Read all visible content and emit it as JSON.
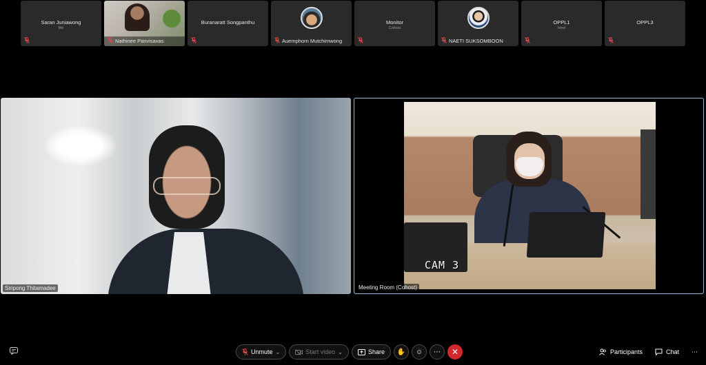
{
  "participants": [
    {
      "name": "Saran Juniawong",
      "role": "Me"
    },
    {
      "name": "Nathinee Panvisavas",
      "role": ""
    },
    {
      "name": "Buranaratt Songpanthu",
      "role": ""
    },
    {
      "name": "Auemphorn Mutchimwong",
      "role": ""
    },
    {
      "name": "Monitor",
      "role": "Cohost"
    },
    {
      "name": "NAETI SUKSOMBOON",
      "role": ""
    },
    {
      "name": "OPPL1",
      "role": "Host"
    },
    {
      "name": "OPPL3",
      "role": ""
    }
  ],
  "main": {
    "left_name": "Siripong Thitamadee",
    "right_name": "Meeting Room (Cohost)",
    "cam_overlay": "CAM 3"
  },
  "controls": {
    "unmute": "Unmute",
    "start_video": "Start video",
    "share": "Share",
    "participants": "Participants",
    "chat": "Chat"
  },
  "colors": {
    "end_call": "#d3272e",
    "active_border": "#9fb7d9",
    "muted_icon": "#e0474c"
  }
}
